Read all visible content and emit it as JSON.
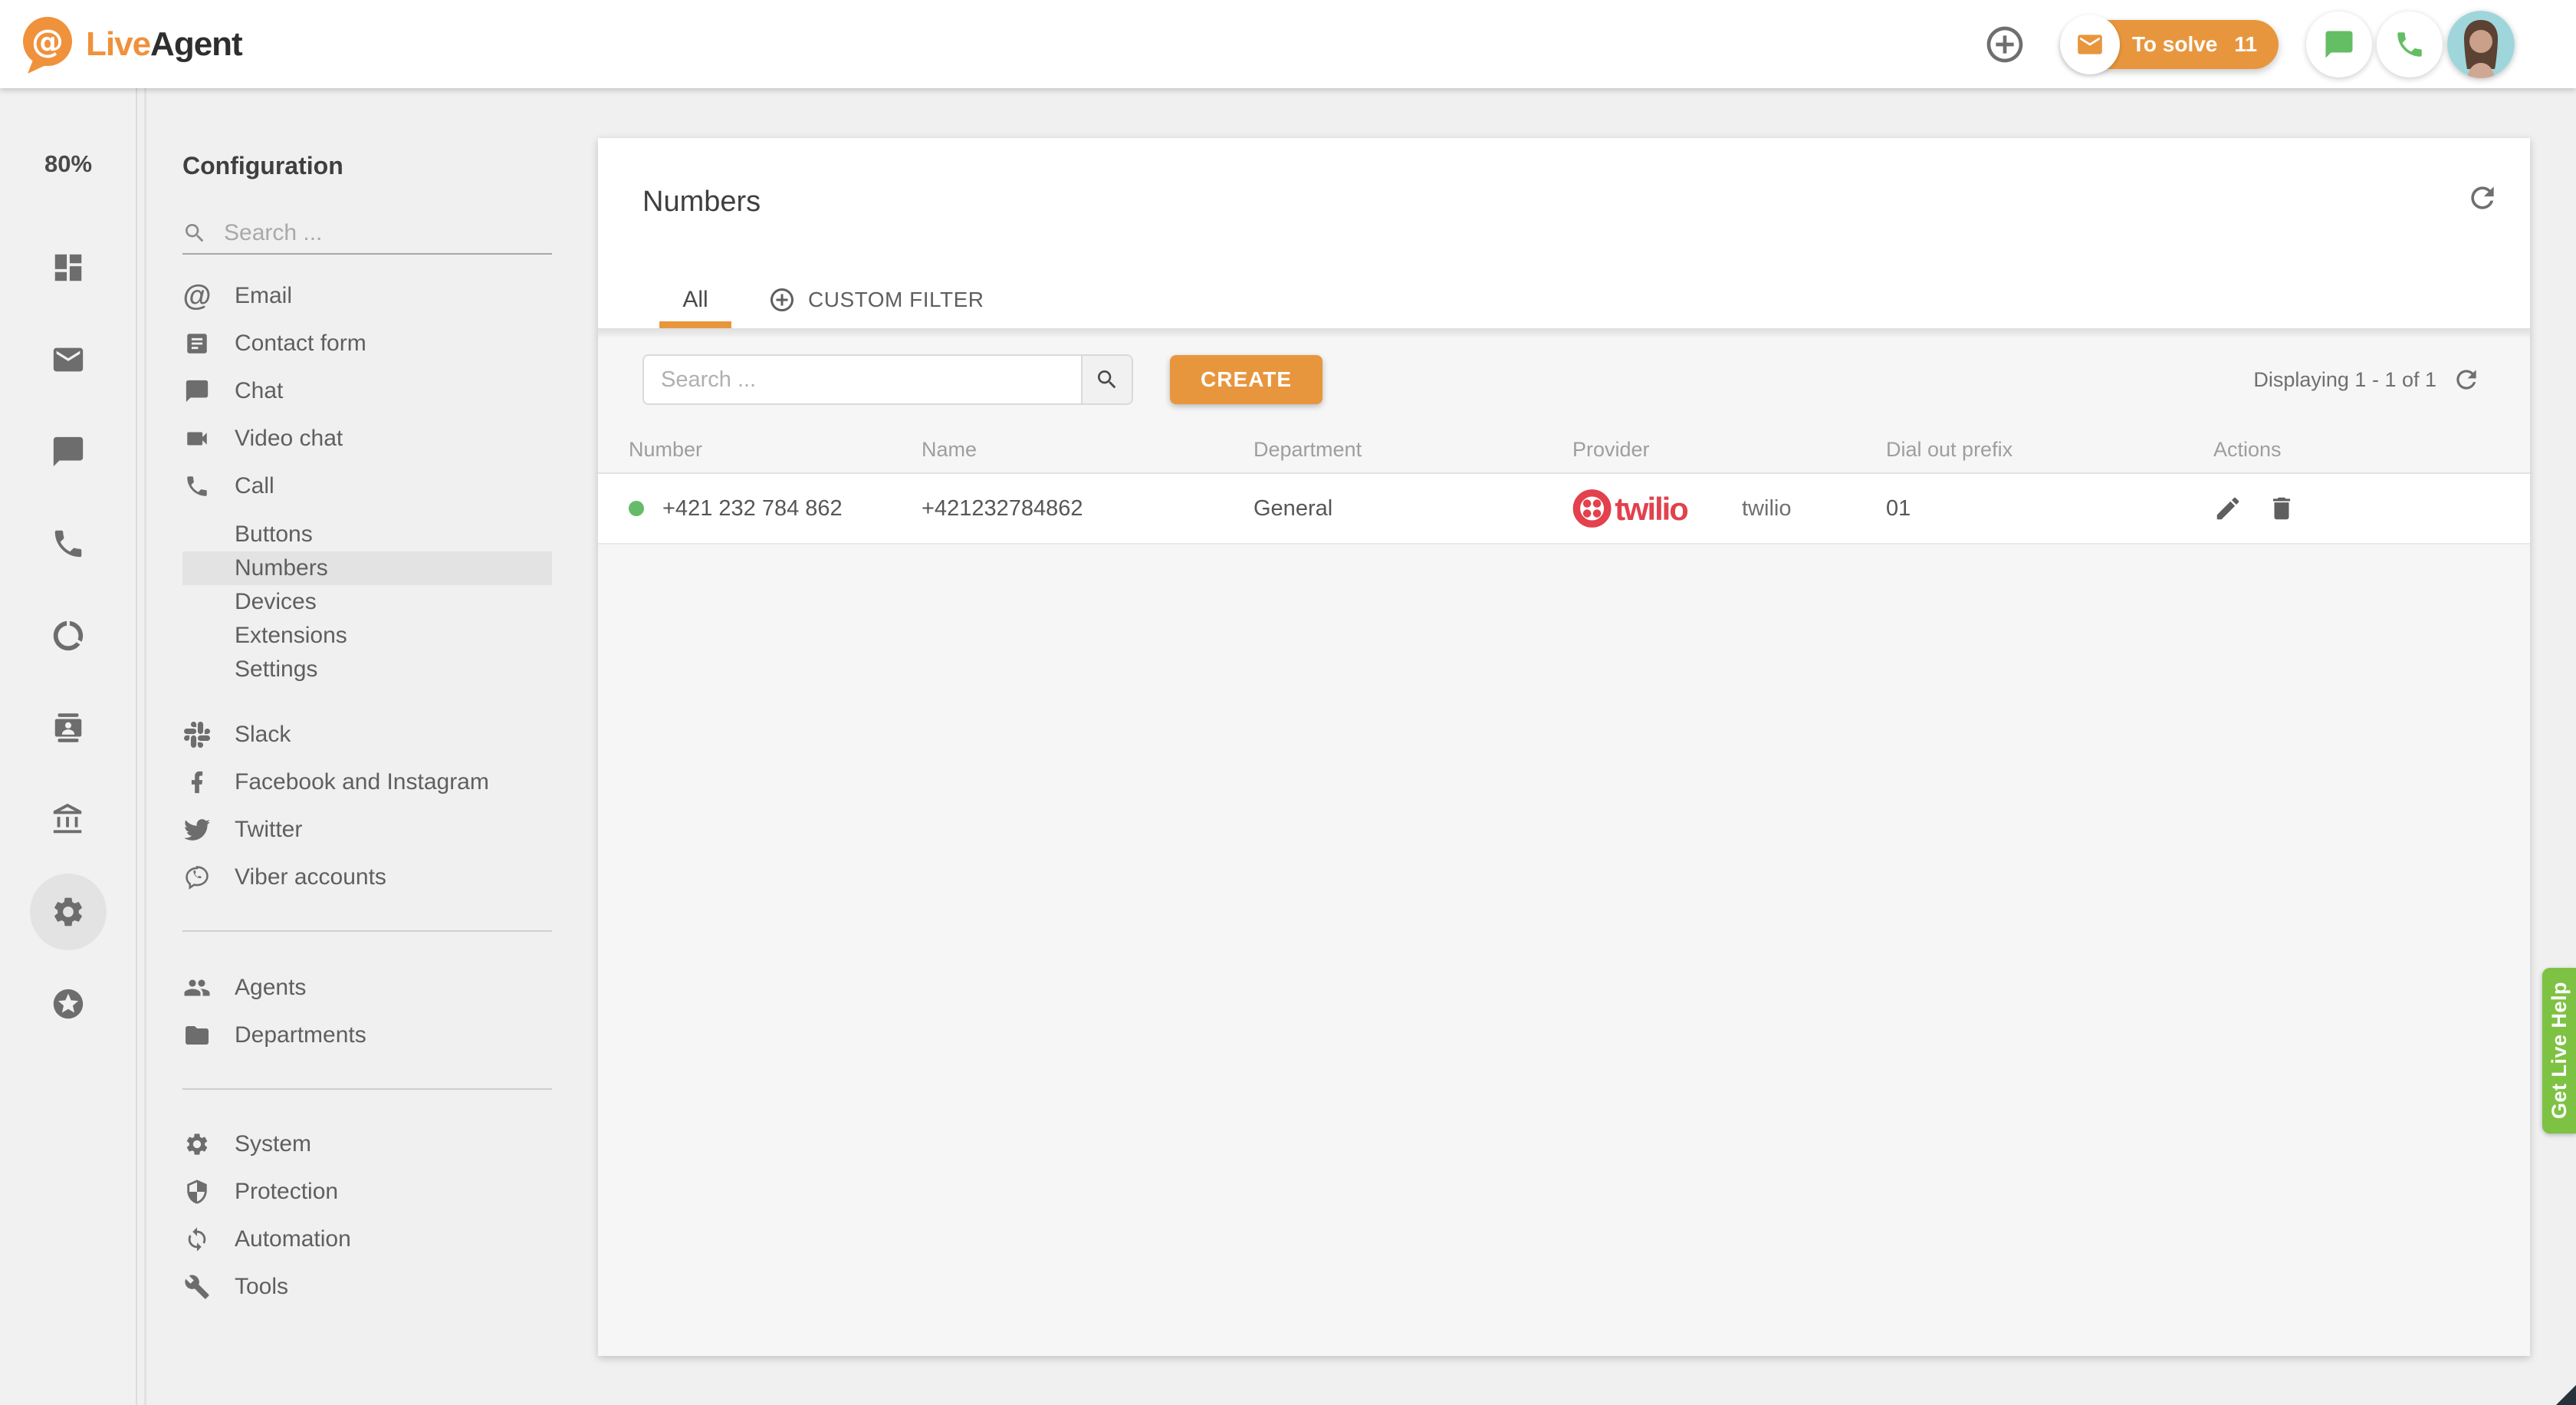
{
  "topbar": {
    "brand_live": "Live",
    "brand_agent": "Agent",
    "to_solve_label": "To solve",
    "to_solve_count": "11"
  },
  "icon_rail": {
    "zoom_level": "80%"
  },
  "config_sidebar": {
    "title": "Configuration",
    "search_placeholder": "Search ...",
    "items": {
      "email": "Email",
      "contact_form": "Contact form",
      "chat": "Chat",
      "video_chat": "Video chat",
      "call": "Call",
      "buttons": "Buttons",
      "numbers": "Numbers",
      "devices": "Devices",
      "extensions": "Extensions",
      "settings": "Settings",
      "slack": "Slack",
      "facebook": "Facebook and Instagram",
      "twitter": "Twitter",
      "viber": "Viber accounts",
      "agents": "Agents",
      "departments": "Departments",
      "system": "System",
      "protection": "Protection",
      "automation": "Automation",
      "tools": "Tools"
    }
  },
  "main": {
    "title": "Numbers",
    "tabs": {
      "all": "All",
      "custom_filter": "CUSTOM FILTER"
    },
    "toolbar": {
      "search_placeholder": "Search ...",
      "create_label": "CREATE",
      "displaying": "Displaying 1 - 1 of 1"
    },
    "table": {
      "headers": [
        "Number",
        "Name",
        "Department",
        "Provider",
        "Dial out prefix",
        "Actions"
      ],
      "rows": [
        {
          "number": "+421 232 784 862",
          "name": "+421232784862",
          "department": "General",
          "provider_brand": "twilio",
          "provider_name": "twilio",
          "dial_out_prefix": "01"
        }
      ]
    }
  },
  "live_help_label": "Get Live Help",
  "colors": {
    "accent_orange": "#E8963E",
    "topbar_icon_green": "#64BE64",
    "help_green": "#7DC242",
    "twilio_red": "#E2414D",
    "status_green": "#66BB6A"
  }
}
